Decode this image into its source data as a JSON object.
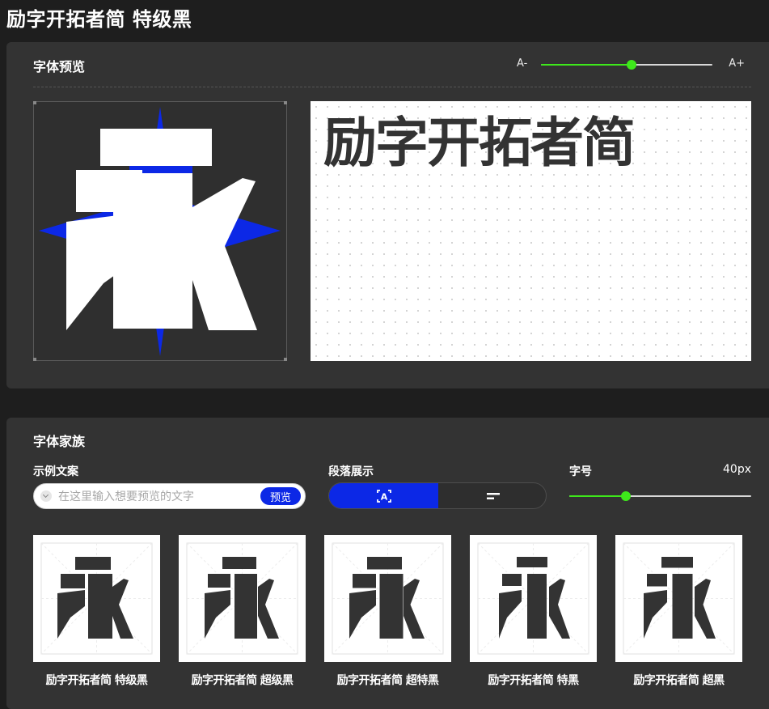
{
  "page_title": "励字开拓者简 特级黑",
  "preview": {
    "heading": "字体预览",
    "size_minus": "A-",
    "size_plus": "A+",
    "size_level": 0.53,
    "glyph_char": "永",
    "preview_text": "励字开拓者简"
  },
  "family": {
    "heading": "字体家族",
    "sample_label": "示例文案",
    "sample_placeholder": "在这里输入想要预览的文字",
    "preview_button": "预览",
    "paragraph_label": "段落展示",
    "fontsize_label": "字号",
    "fontsize_value": "40px",
    "fontsize_level": 0.31,
    "cards": [
      {
        "label": "励字开拓者简 特级黑"
      },
      {
        "label": "励字开拓者简 超级黑"
      },
      {
        "label": "励字开拓者简 超特黑"
      },
      {
        "label": "励字开拓者简 特黑"
      },
      {
        "label": "励字开拓者简 超黑"
      }
    ]
  },
  "colors": {
    "accent_blue": "#0c28e6",
    "accent_green": "#3ee81b",
    "panel_bg": "#333333",
    "page_bg": "#1e1e1e"
  },
  "icons": {
    "toggle_first": "text-frame-icon",
    "toggle_second": "align-left-icon",
    "input_prefix": "chevron-down-icon"
  }
}
